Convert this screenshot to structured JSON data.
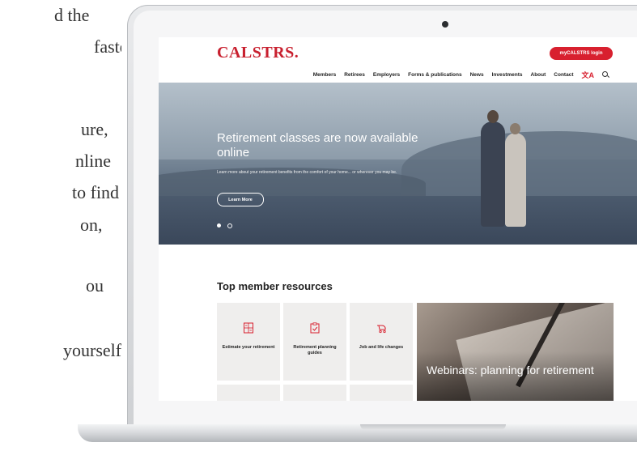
{
  "prose_lines": [
    "d the",
    "faster",
    "ure,",
    "nline",
    "to find",
    "on,",
    "ou",
    "yourself"
  ],
  "site": {
    "logo": "CALSTRS.",
    "login_label": "myCALSTRS login",
    "nav": [
      "Members",
      "Retirees",
      "Employers",
      "Forms & publications",
      "News",
      "Investments",
      "About",
      "Contact"
    ],
    "lang_icon_glyph": "文A"
  },
  "hero": {
    "title": "Retirement classes are now available online",
    "text": "Learn more about your retirement benefits from the comfort of your home... or wherever you may be.",
    "button": "Learn More",
    "slide_count": 2,
    "active_slide": 1
  },
  "resources": {
    "title": "Top member resources",
    "tiles": [
      {
        "label": "Estimate your retirement",
        "icon": "calculator-icon"
      },
      {
        "label": "Retirement planning guides",
        "icon": "clipboard-check-icon"
      },
      {
        "label": "Job and life changes",
        "icon": "stroller-icon"
      }
    ],
    "feature": "Webinars: planning for retirement"
  },
  "colors": {
    "brand_red": "#d8202f",
    "tile_bg": "#efeeed"
  }
}
